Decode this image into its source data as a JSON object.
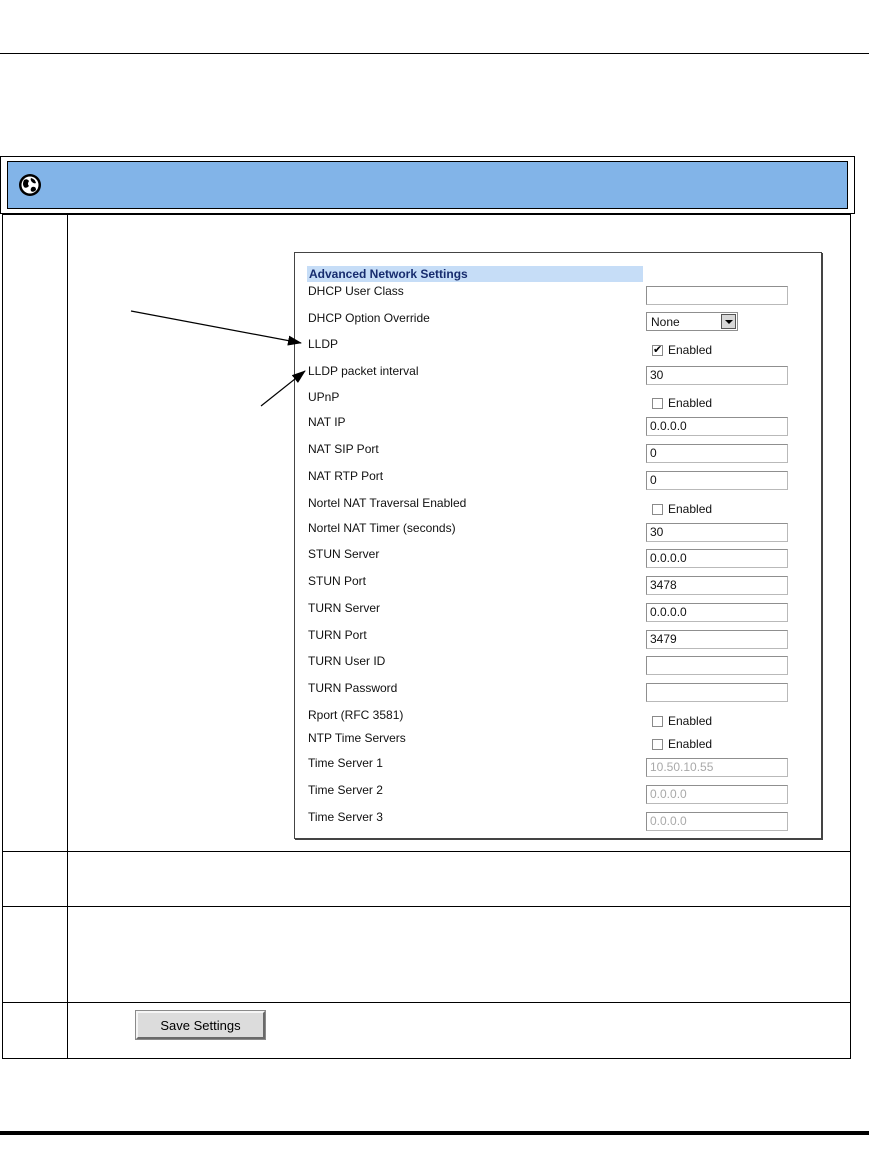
{
  "panel": {
    "title": "Advanced Network Settings",
    "rows": [
      {
        "label": "DHCP User Class",
        "kind": "text",
        "value": ""
      },
      {
        "label": "DHCP Option Override",
        "kind": "select",
        "value": "None"
      },
      {
        "label": "LLDP",
        "kind": "checkbox",
        "checked": true,
        "checkbox_label": "Enabled"
      },
      {
        "label": "LLDP packet interval",
        "kind": "text",
        "value": "30"
      },
      {
        "label": "UPnP",
        "kind": "checkbox",
        "checked": false,
        "checkbox_label": "Enabled"
      },
      {
        "label": "NAT IP",
        "kind": "text",
        "value": "0.0.0.0"
      },
      {
        "label": "NAT SIP Port",
        "kind": "text",
        "value": "0"
      },
      {
        "label": "NAT RTP Port",
        "kind": "text",
        "value": "0"
      },
      {
        "label": "Nortel NAT Traversal Enabled",
        "kind": "checkbox",
        "checked": false,
        "checkbox_label": "Enabled"
      },
      {
        "label": "Nortel NAT Timer (seconds)",
        "kind": "text",
        "value": "30"
      },
      {
        "label": "STUN Server",
        "kind": "text",
        "value": "0.0.0.0"
      },
      {
        "label": "STUN Port",
        "kind": "text",
        "value": "3478"
      },
      {
        "label": "TURN Server",
        "kind": "text",
        "value": "0.0.0.0"
      },
      {
        "label": "TURN Port",
        "kind": "text",
        "value": "3479"
      },
      {
        "label": "TURN User ID",
        "kind": "text",
        "value": ""
      },
      {
        "label": "TURN Password",
        "kind": "text",
        "value": ""
      },
      {
        "label": "Rport (RFC 3581)",
        "kind": "checkbox",
        "checked": false,
        "checkbox_label": "Enabled"
      },
      {
        "label": "NTP Time Servers",
        "kind": "checkbox",
        "checked": false,
        "checkbox_label": "Enabled"
      },
      {
        "label": "Time Server 1",
        "kind": "text",
        "value": "10.50.10.55",
        "disabled": true
      },
      {
        "label": "Time Server 2",
        "kind": "text",
        "value": "0.0.0.0",
        "disabled": true
      },
      {
        "label": "Time Server 3",
        "kind": "text",
        "value": "0.0.0.0",
        "disabled": true
      }
    ]
  },
  "save_button": {
    "label": "Save Settings"
  },
  "icons": {
    "header": "globe-icon"
  },
  "colors": {
    "title_bar": "#82b4e8",
    "panel_header": "#c6ddf7",
    "panel_title": "#172c6e"
  }
}
